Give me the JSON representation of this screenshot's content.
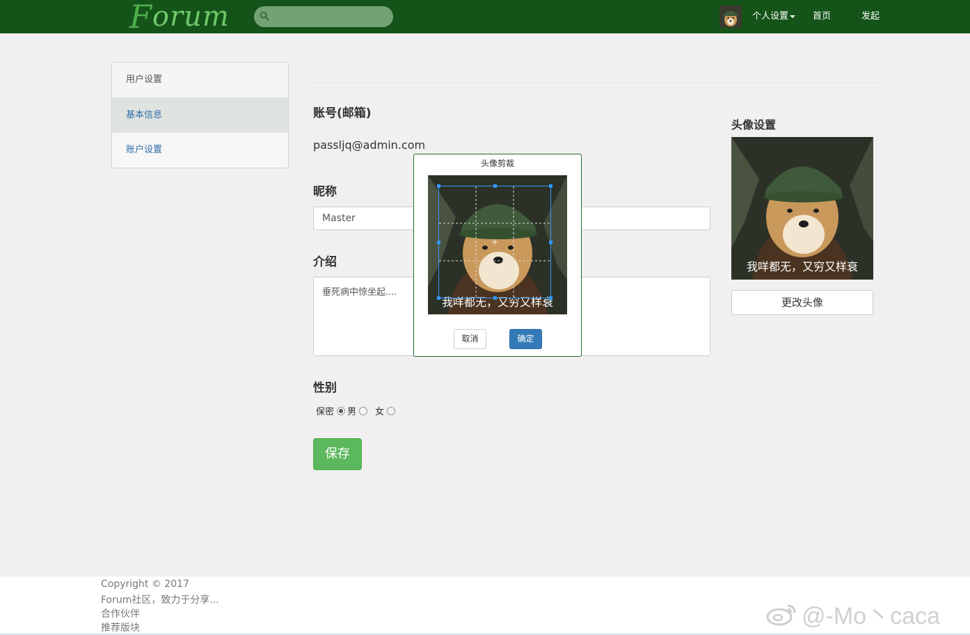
{
  "navbar": {
    "logo_first": "F",
    "logo_rest": "orum",
    "nav_items": [
      {
        "label": "个人设置"
      },
      {
        "label": "首页"
      },
      {
        "label": "发起"
      }
    ]
  },
  "sidebar": {
    "items": [
      {
        "label": "用户设置"
      },
      {
        "label": "基本信息"
      },
      {
        "label": "账户设置"
      }
    ]
  },
  "form": {
    "account_label": "账号(邮箱)",
    "account_value": "passljq@admin.com",
    "nickname_label": "昵称",
    "nickname_value": "Master",
    "intro_label": "介绍",
    "intro_value": "垂死病中惊坐起....",
    "gender_label": "性别",
    "gender_options": [
      "保密",
      "男",
      "女"
    ],
    "gender_selected": "保密",
    "save_label": "保存"
  },
  "avatar": {
    "title": "头像设置",
    "change_label": "更改头像",
    "caption": "我咩都无，又穷又样衰"
  },
  "modal": {
    "title": "头像剪裁",
    "cancel_label": "取消",
    "ok_label": "确定",
    "caption": "我咩都无，又穷又样衰"
  },
  "footer": {
    "lines": [
      "Copyright © 2017",
      "Forum社区，致力于分享...",
      "合作伙伴",
      "推荐版块"
    ],
    "watermark": "@-Mo丶caca"
  },
  "colors": {
    "navbar_bg": "#145419",
    "save_button": "#5cb85c",
    "ok_button": "#337ab7",
    "link": "#2f6ea8"
  }
}
